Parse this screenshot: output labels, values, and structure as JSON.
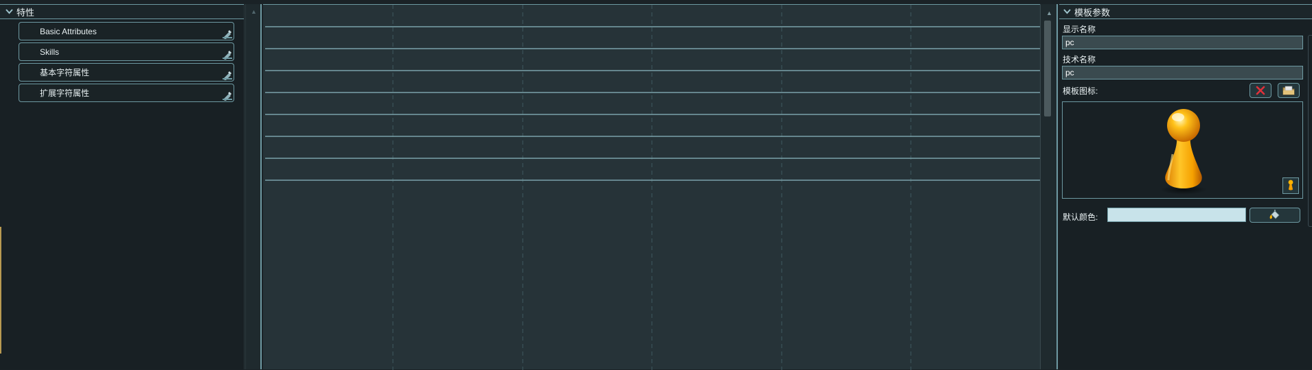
{
  "left_panel": {
    "title": "特性",
    "items": [
      {
        "label": "Basic Attributes"
      },
      {
        "label": "Skills"
      },
      {
        "label": "基本字符属性"
      },
      {
        "label": "扩展字符属性"
      }
    ]
  },
  "right_panel": {
    "title": "模板参数",
    "display_name_label": "显示名称",
    "display_name_value": "pc",
    "tech_name_label": "技术名称",
    "tech_name_value": "pc",
    "icon_label": "模板图标:",
    "default_color_label": "默认颜色:",
    "default_color": "#c8e3ea"
  },
  "colors": {
    "accent_border": "#6e9aa3",
    "canvas_bg": "#263338",
    "panel_bg": "#182024",
    "clear_icon": "#e0303a",
    "pawn_orange": "#f5a000"
  },
  "icons": {
    "collapse": "chevron-down-icon",
    "edit": "pencil-ruler-icon",
    "clear": "x-icon",
    "open": "folder-icon",
    "pawn": "pawn-icon",
    "color_pick": "paint-bucket-icon"
  }
}
